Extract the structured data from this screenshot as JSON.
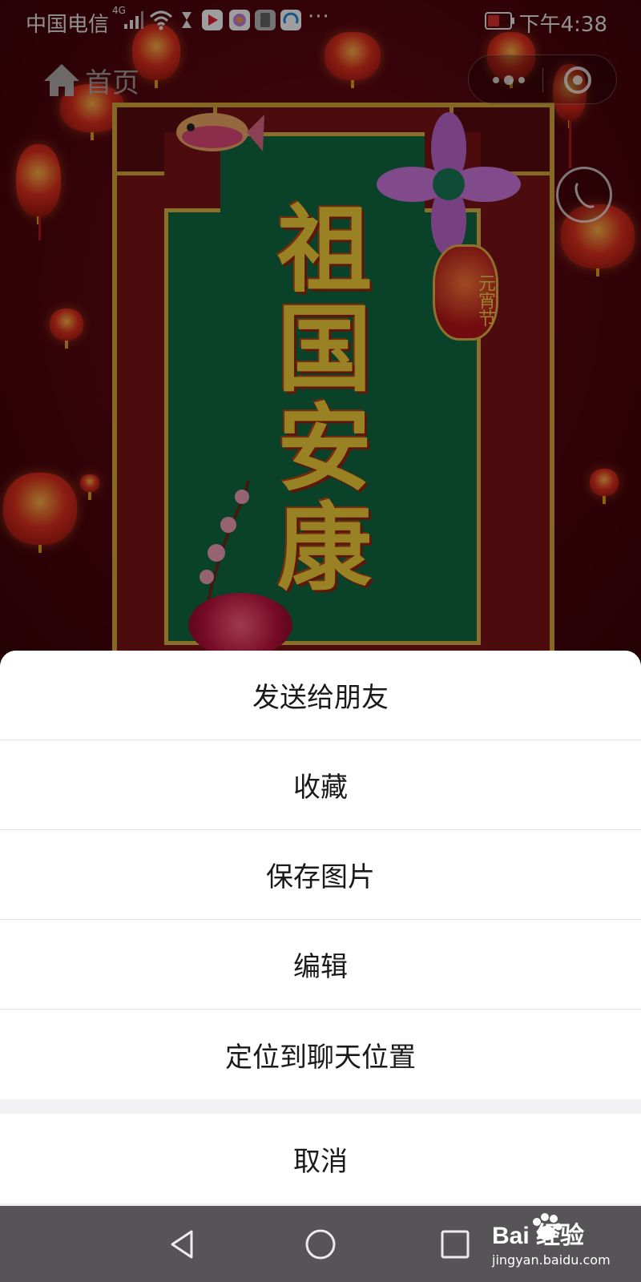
{
  "status_bar": {
    "carrier": "中国电信",
    "network": "4G",
    "more": "···",
    "time": "下午4:38"
  },
  "header": {
    "home_label": "首页"
  },
  "background_image": {
    "vertical_text": [
      "祖",
      "国",
      "安",
      "康"
    ],
    "lantern_label": "元宵节"
  },
  "action_sheet": {
    "items": [
      {
        "label": "发送给朋友"
      },
      {
        "label": "收藏"
      },
      {
        "label": "保存图片"
      },
      {
        "label": "编辑"
      },
      {
        "label": "定位到聊天位置"
      }
    ],
    "cancel_label": "取消"
  },
  "watermark": {
    "brand": "Bai  经验",
    "url": "jingyan.baidu.com"
  },
  "colors": {
    "sheet_background": "#ffffff",
    "sheet_separator": "#f2f2f4",
    "nav_bar": "#565456",
    "panel_green": "#106b43",
    "text_gold": "#f5d23a"
  }
}
